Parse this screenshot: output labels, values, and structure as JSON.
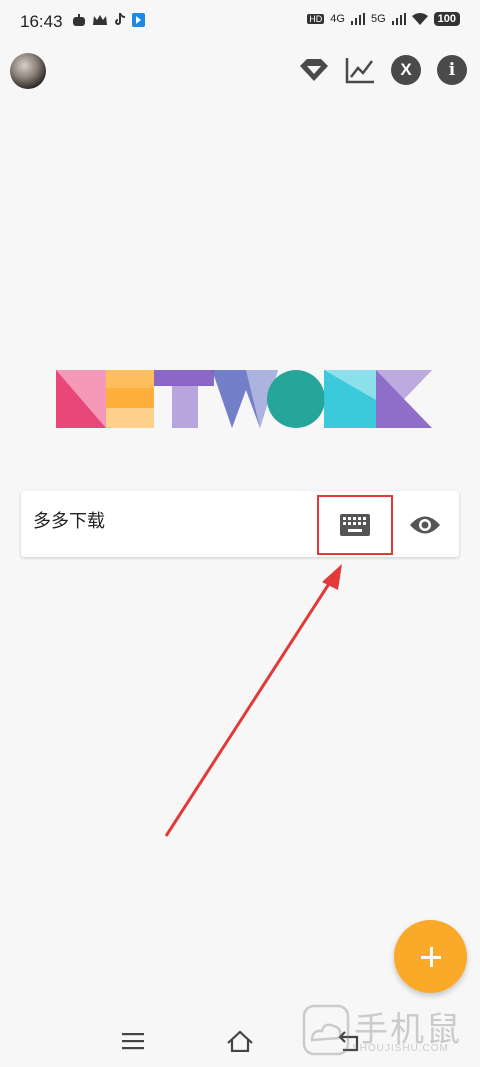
{
  "status_bar": {
    "time": "16:43",
    "network_labels": [
      "HD",
      "4G",
      "5G"
    ],
    "battery": "100"
  },
  "toolbar": {
    "icons": [
      "diamond-icon",
      "chart-icon",
      "x-icon",
      "info-icon"
    ],
    "x_label": "X",
    "info_label": "i"
  },
  "logo": {
    "text": "NETWORK",
    "colors": [
      "#e8336d",
      "#ffa726",
      "#7e57c2",
      "#5c6bc0",
      "#26a69a",
      "#26c6da",
      "#7e57c2"
    ]
  },
  "input_card": {
    "value": "多多下载"
  },
  "annotation": {
    "highlight_color": "#e23a3a"
  },
  "fab": {
    "symbol": "+",
    "color": "#fba929"
  },
  "navigation": {
    "items": [
      "menu-icon",
      "home-icon",
      "back-icon"
    ]
  },
  "watermark": {
    "title": "手机鼠",
    "subtitle": "SHOUJISHU.COM"
  }
}
